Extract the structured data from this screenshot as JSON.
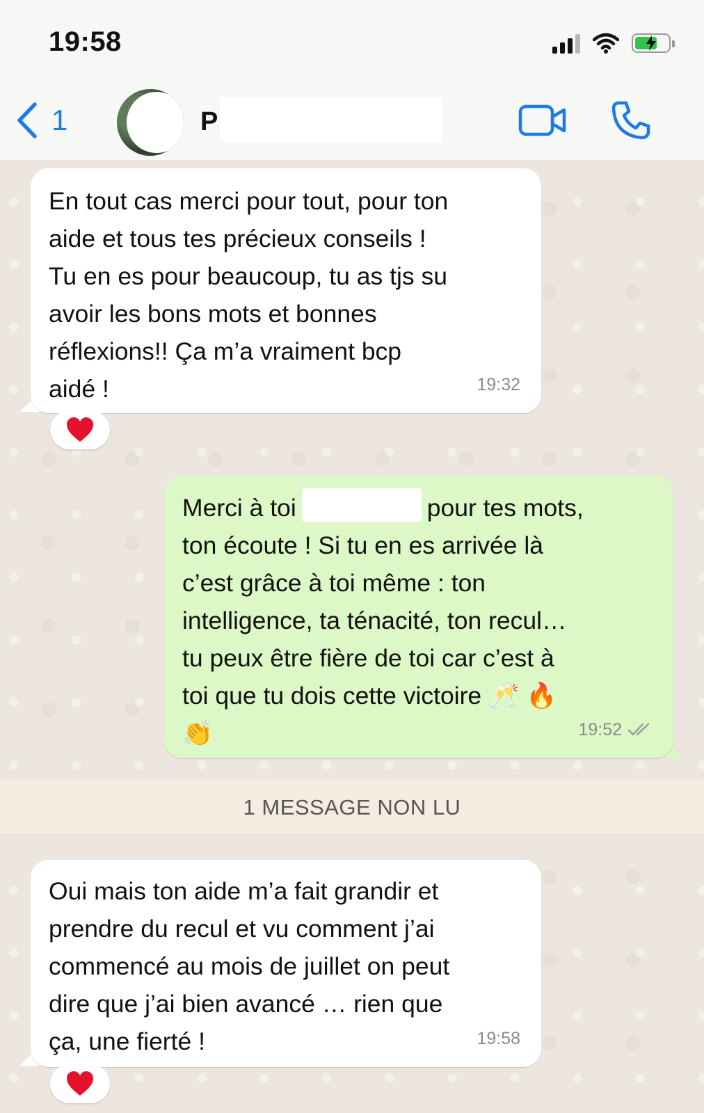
{
  "status_bar": {
    "time": "19:58",
    "icons": [
      "cellular-signal-icon",
      "wifi-icon",
      "battery-charging-icon"
    ]
  },
  "header": {
    "back_count": "1",
    "contact_initial": "P",
    "icons": [
      "chevron-left-icon",
      "video-call-icon",
      "phone-call-icon"
    ]
  },
  "messages": [
    {
      "direction": "incoming",
      "text": "En tout cas merci pour tout, pour ton\naide et tous tes précieux conseils !\nTu en es pour beaucoup, tu as tjs su\navoir les bons mots et bonnes\nréflexions!! Ça m’a vraiment bcp\naidé !",
      "time": "19:32",
      "reaction": "❤️"
    },
    {
      "direction": "outgoing",
      "text_before": "Merci à toi",
      "text_after": "pour tes mots,",
      "text_rest": "ton écoute ! Si tu en es arrivée là\nc’est grâce à toi même : ton\nintelligence, ta ténacité, ton recul…\ntu peux être fière de toi car c’est à\ntoi que tu dois cette victoire 🥂 🔥\n👏",
      "time": "19:52",
      "read_receipt": "double-check-icon"
    },
    {
      "direction": "incoming",
      "text": "Oui mais ton aide m’a fait grandir et\nprendre du recul et vu comment j’ai\ncommencé au mois de juillet on peut\ndire que j’ai bien avancé … rien que\nça, une fierté !",
      "time": "19:58",
      "reaction": "❤️"
    }
  ],
  "unread_banner": "1 MESSAGE NON LU",
  "colors": {
    "accent": "#1e7ae6",
    "incoming_bubble": "#ffffff",
    "outgoing_bubble": "#dcf8c6",
    "banner": "#f6ece2",
    "battery": "#32c34a"
  }
}
